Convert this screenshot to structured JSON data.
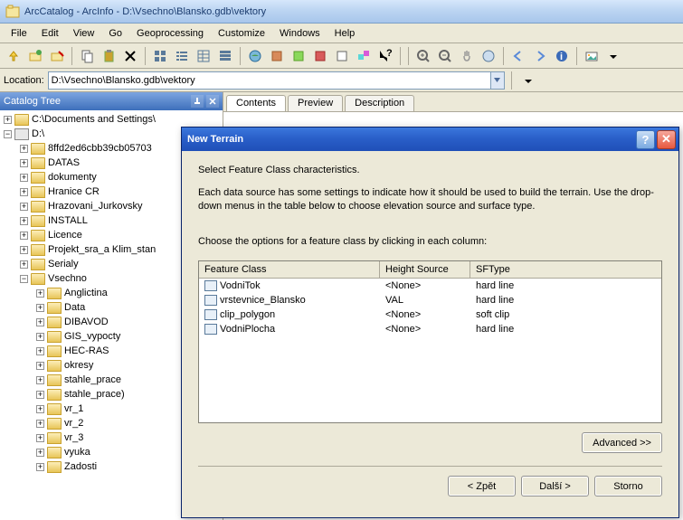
{
  "window": {
    "title": "ArcCatalog - ArcInfo - D:\\Vsechno\\Blansko.gdb\\vektory"
  },
  "menu": {
    "items": [
      "File",
      "Edit",
      "View",
      "Go",
      "Geoprocessing",
      "Customize",
      "Windows",
      "Help"
    ]
  },
  "location": {
    "label": "Location:",
    "value": "D:\\Vsechno\\Blansko.gdb\\vektory"
  },
  "catalog": {
    "title": "Catalog Tree",
    "nodes": [
      {
        "depth": 0,
        "expand": "+",
        "icon": "folder",
        "label": "C:\\Documents and Settings\\"
      },
      {
        "depth": 0,
        "expand": "-",
        "icon": "drive",
        "label": "D:\\"
      },
      {
        "depth": 1,
        "expand": "+",
        "icon": "folder",
        "label": "8ffd2ed6cbb39cb05703"
      },
      {
        "depth": 1,
        "expand": "+",
        "icon": "folder",
        "label": "DATAS"
      },
      {
        "depth": 1,
        "expand": "+",
        "icon": "folder",
        "label": "dokumenty"
      },
      {
        "depth": 1,
        "expand": "+",
        "icon": "folder",
        "label": "Hranice CR"
      },
      {
        "depth": 1,
        "expand": "+",
        "icon": "folder",
        "label": "Hrazovani_Jurkovsky"
      },
      {
        "depth": 1,
        "expand": "+",
        "icon": "folder",
        "label": "INSTALL"
      },
      {
        "depth": 1,
        "expand": "+",
        "icon": "folder",
        "label": "Licence"
      },
      {
        "depth": 1,
        "expand": "+",
        "icon": "folder",
        "label": "Projekt_sra_a Klim_stan"
      },
      {
        "depth": 1,
        "expand": "+",
        "icon": "folder",
        "label": "Serialy"
      },
      {
        "depth": 1,
        "expand": "-",
        "icon": "folder",
        "label": "Vsechno"
      },
      {
        "depth": 2,
        "expand": "+",
        "icon": "folder",
        "label": "Anglictina"
      },
      {
        "depth": 2,
        "expand": "+",
        "icon": "folder",
        "label": "Data"
      },
      {
        "depth": 2,
        "expand": "+",
        "icon": "folder",
        "label": "DIBAVOD"
      },
      {
        "depth": 2,
        "expand": "+",
        "icon": "folder",
        "label": "GIS_vypocty"
      },
      {
        "depth": 2,
        "expand": "+",
        "icon": "folder",
        "label": "HEC-RAS"
      },
      {
        "depth": 2,
        "expand": "+",
        "icon": "folder",
        "label": "okresy"
      },
      {
        "depth": 2,
        "expand": "+",
        "icon": "folder",
        "label": "stahle_prace"
      },
      {
        "depth": 2,
        "expand": "+",
        "icon": "folder",
        "label": "stahle_prace)"
      },
      {
        "depth": 2,
        "expand": "+",
        "icon": "folder",
        "label": "vr_1"
      },
      {
        "depth": 2,
        "expand": "+",
        "icon": "folder",
        "label": "vr_2"
      },
      {
        "depth": 2,
        "expand": "+",
        "icon": "folder",
        "label": "vr_3"
      },
      {
        "depth": 2,
        "expand": "+",
        "icon": "folder",
        "label": "vyuka"
      },
      {
        "depth": 2,
        "expand": "+",
        "icon": "folder",
        "label": "Zadosti"
      }
    ]
  },
  "tabs": {
    "items": [
      "Contents",
      "Preview",
      "Description"
    ],
    "active": 0
  },
  "dialog": {
    "title": "New Terrain",
    "intro": "Select Feature Class characteristics.",
    "desc": "Each data source has some settings to indicate how it should be used to build the terrain.  Use the drop-down menus in the table below to choose elevation source and surface type.",
    "instruct": "Choose the options for a feature class by clicking in each column:",
    "headers": {
      "c1": "Feature Class",
      "c2": "Height Source",
      "c3": "SFType"
    },
    "rows": [
      {
        "fc": "VodniTok",
        "hs": "<None>",
        "sf": "hard line"
      },
      {
        "fc": "vrstevnice_Blansko",
        "hs": "VAL",
        "sf": "hard line"
      },
      {
        "fc": "clip_polygon",
        "hs": "<None>",
        "sf": "soft clip"
      },
      {
        "fc": "VodniPlocha",
        "hs": "<None>",
        "sf": "hard line"
      }
    ],
    "advanced": "Advanced >>",
    "back": "< Zpět",
    "next": "Další >",
    "cancel": "Storno"
  }
}
